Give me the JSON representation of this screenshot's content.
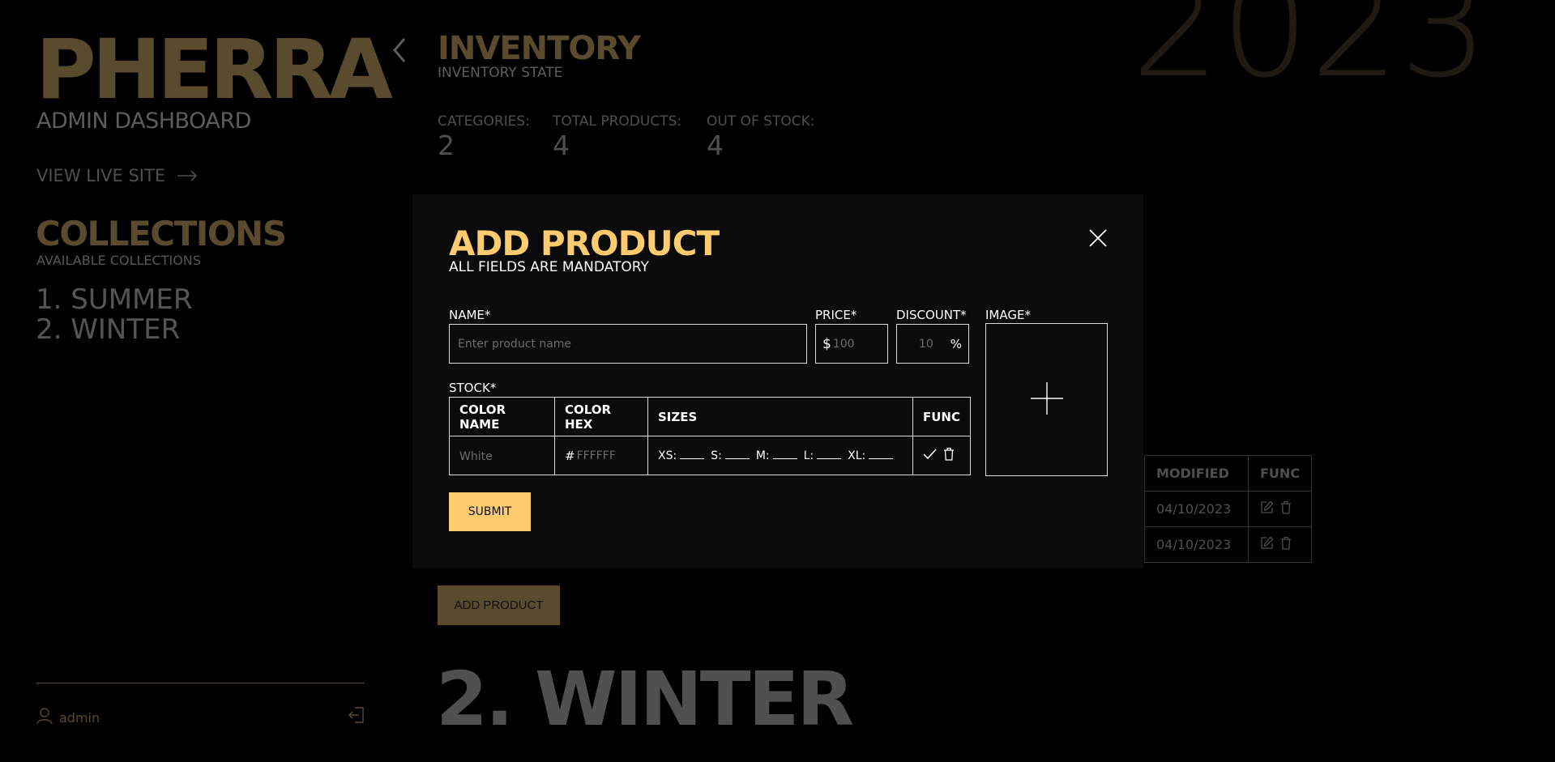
{
  "sidebar": {
    "brand": "PHERRA",
    "subtitle": "ADMIN DASHBOARD",
    "live_link": "VIEW LIVE SITE",
    "collections_title": "COLLECTIONS",
    "collections_subtitle": "AVAILABLE COLLECTIONS",
    "collections": [
      "1. SUMMER",
      "2. WINTER"
    ],
    "username": "admin"
  },
  "header": {
    "title": "INVENTORY",
    "subtitle": "INVENTORY STATE",
    "year": "2023"
  },
  "stats": [
    {
      "label": "CATEGORIES:",
      "value": "2"
    },
    {
      "label": "TOTAL PRODUCTS:",
      "value": "4"
    },
    {
      "label": "OUT OF STOCK:",
      "value": "4"
    }
  ],
  "products_table": {
    "headers": [
      "MODIFIED",
      "FUNC"
    ],
    "rows": [
      {
        "modified": "04/10/2023"
      },
      {
        "modified": "04/10/2023"
      }
    ]
  },
  "add_product_button": "ADD PRODUCT",
  "section_title": "2. WINTER",
  "modal": {
    "title": "ADD PRODUCT",
    "subtitle": "ALL FIELDS ARE MANDATORY",
    "name_label": "NAME*",
    "name_placeholder": "Enter product name",
    "price_label": "PRICE*",
    "price_currency": "$",
    "price_placeholder": "100",
    "discount_label": "DISCOUNT*",
    "discount_placeholder": "10",
    "discount_unit": "%",
    "image_label": "IMAGE*",
    "stock_label": "STOCK*",
    "stock_headers": [
      "COLOR NAME",
      "COLOR HEX",
      "SIZES",
      "FUNC"
    ],
    "color_name_placeholder": "White",
    "hex_prefix": "#",
    "hex_placeholder": "FFFFFF",
    "sizes": [
      "XS:",
      "S:",
      "M:",
      "L:",
      "XL:"
    ],
    "submit_label": "SUBMIT"
  },
  "colors": {
    "accent": "#fecb6e",
    "accent_dim": "#5a4a2e",
    "modal_bg": "#0b0b0b"
  }
}
